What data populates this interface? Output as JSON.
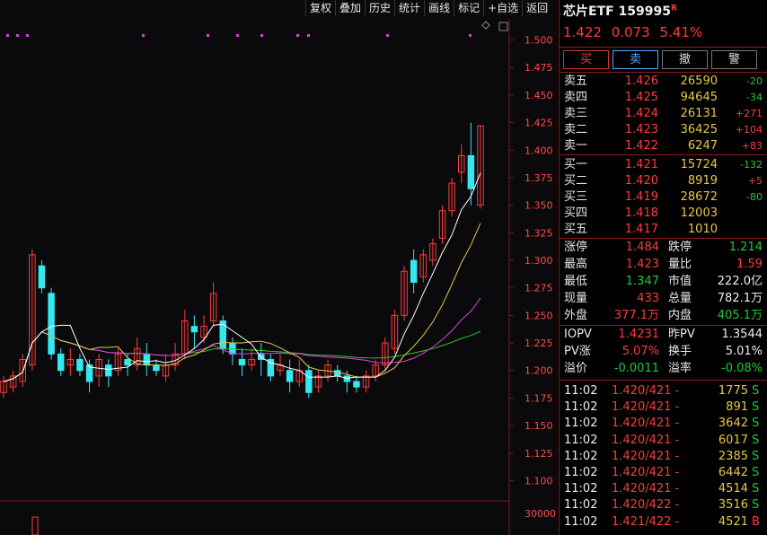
{
  "toolbar": [
    "复权",
    "叠加",
    "历史",
    "统计",
    "画线",
    "标记",
    "+自选",
    "返回"
  ],
  "quote": {
    "name": "芯片ETF 159995",
    "flag": "R",
    "price": "1.422",
    "change": "0.073",
    "pct": "5.41%"
  },
  "actions": [
    "买",
    "卖",
    "撤",
    "警"
  ],
  "asks": [
    {
      "label": "卖五",
      "price": "1.426",
      "vol": "26590",
      "delta": "-20"
    },
    {
      "label": "卖四",
      "price": "1.425",
      "vol": "94645",
      "delta": "-34"
    },
    {
      "label": "卖三",
      "price": "1.424",
      "vol": "26131",
      "delta": "+271"
    },
    {
      "label": "卖二",
      "price": "1.423",
      "vol": "36425",
      "delta": "+104"
    },
    {
      "label": "卖一",
      "price": "1.422",
      "vol": "6247",
      "delta": "+83"
    }
  ],
  "bids": [
    {
      "label": "买一",
      "price": "1.421",
      "vol": "15724",
      "delta": "-132"
    },
    {
      "label": "买二",
      "price": "1.420",
      "vol": "8919",
      "delta": "+5"
    },
    {
      "label": "买三",
      "price": "1.419",
      "vol": "28672",
      "delta": "-80"
    },
    {
      "label": "买四",
      "price": "1.418",
      "vol": "12003",
      "delta": ""
    },
    {
      "label": "买五",
      "price": "1.417",
      "vol": "1010",
      "delta": ""
    }
  ],
  "stats": [
    {
      "k1": "涨停",
      "v1": "1.484",
      "c1": "red",
      "k2": "跌停",
      "v2": "1.214",
      "c2": "grn"
    },
    {
      "k1": "最高",
      "v1": "1.423",
      "c1": "red",
      "k2": "量比",
      "v2": "1.59",
      "c2": "red"
    },
    {
      "k1": "最低",
      "v1": "1.347",
      "c1": "grn",
      "k2": "市值",
      "v2": "222.0亿",
      "c2": "wht"
    },
    {
      "k1": "现量",
      "v1": "433",
      "c1": "red",
      "k2": "总量",
      "v2": "782.1万",
      "c2": "wht"
    },
    {
      "k1": "外盘",
      "v1": "377.1万",
      "c1": "red",
      "k2": "内盘",
      "v2": "405.1万",
      "c2": "grn"
    }
  ],
  "stats2": [
    {
      "k1": "IOPV",
      "v1": "1.4231",
      "c1": "red",
      "k2": "昨PV",
      "v2": "1.3544",
      "c2": "wht"
    },
    {
      "k1": "PV涨",
      "v1": "5.07%",
      "c1": "red",
      "k2": "换手",
      "v2": "5.01%",
      "c2": "wht"
    },
    {
      "k1": "溢价",
      "v1": "-0.0011",
      "c1": "grn",
      "k2": "溢率",
      "v2": "-0.08%",
      "c2": "grn"
    }
  ],
  "ticks": [
    {
      "time": "11:02",
      "price": "1.420/421 -",
      "vol": "1775",
      "side": "S"
    },
    {
      "time": "11:02",
      "price": "1.420/421 -",
      "vol": "891",
      "side": "S"
    },
    {
      "time": "11:02",
      "price": "1.420/421 -",
      "vol": "3642",
      "side": "S"
    },
    {
      "time": "11:02",
      "price": "1.420/421 -",
      "vol": "6017",
      "side": "S"
    },
    {
      "time": "11:02",
      "price": "1.420/421 -",
      "vol": "2385",
      "side": "S"
    },
    {
      "time": "11:02",
      "price": "1.420/421 -",
      "vol": "6442",
      "side": "S"
    },
    {
      "time": "11:02",
      "price": "1.420/421 -",
      "vol": "4514",
      "side": "S"
    },
    {
      "time": "11:02",
      "price": "1.420/422 -",
      "vol": "3516",
      "side": "S"
    },
    {
      "time": "11:02",
      "price": "1.421/422 -",
      "vol": "4521",
      "side": "B"
    }
  ],
  "chart_data": {
    "type": "candlestick",
    "ylim": [
      1.08,
      1.52
    ],
    "yticks": [
      "1.500",
      "1.475",
      "1.450",
      "1.425",
      "1.400",
      "1.375",
      "1.350",
      "1.325",
      "1.300",
      "1.275",
      "1.250",
      "1.225",
      "1.200",
      "1.175",
      "1.150",
      "1.125",
      "1.100"
    ],
    "volume_tick": "30000",
    "grid": false,
    "colors": {
      "up": "#ff3b3b",
      "down": "#34e8f0",
      "ma5": "#ffffff",
      "ma10": "#e6c846",
      "ma20": "#e040e0",
      "ma60": "#2ec82e"
    },
    "candles": [
      [
        1.18,
        1.19,
        1.175,
        1.195
      ],
      [
        1.185,
        1.195,
        1.18,
        1.2
      ],
      [
        1.19,
        1.21,
        1.185,
        1.215
      ],
      [
        1.205,
        1.305,
        1.2,
        1.31
      ],
      [
        1.295,
        1.275,
        1.27,
        1.3
      ],
      [
        1.27,
        1.215,
        1.21,
        1.275
      ],
      [
        1.215,
        1.2,
        1.195,
        1.22
      ],
      [
        1.205,
        1.21,
        1.195,
        1.22
      ],
      [
        1.21,
        1.2,
        1.195,
        1.215
      ],
      [
        1.205,
        1.19,
        1.18,
        1.21
      ],
      [
        1.195,
        1.21,
        1.185,
        1.215
      ],
      [
        1.205,
        1.195,
        1.185,
        1.21
      ],
      [
        1.2,
        1.215,
        1.195,
        1.22
      ],
      [
        1.21,
        1.205,
        1.195,
        1.215
      ],
      [
        1.205,
        1.22,
        1.2,
        1.23
      ],
      [
        1.215,
        1.205,
        1.195,
        1.225
      ],
      [
        1.205,
        1.2,
        1.195,
        1.21
      ],
      [
        1.195,
        1.205,
        1.19,
        1.215
      ],
      [
        1.205,
        1.215,
        1.2,
        1.225
      ],
      [
        1.215,
        1.245,
        1.21,
        1.255
      ],
      [
        1.24,
        1.235,
        1.22,
        1.25
      ],
      [
        1.23,
        1.24,
        1.225,
        1.25
      ],
      [
        1.245,
        1.27,
        1.24,
        1.28
      ],
      [
        1.245,
        1.22,
        1.215,
        1.25
      ],
      [
        1.225,
        1.215,
        1.205,
        1.23
      ],
      [
        1.21,
        1.205,
        1.195,
        1.22
      ],
      [
        1.205,
        1.21,
        1.2,
        1.22
      ],
      [
        1.215,
        1.21,
        1.195,
        1.225
      ],
      [
        1.21,
        1.195,
        1.19,
        1.215
      ],
      [
        1.2,
        1.205,
        1.195,
        1.215
      ],
      [
        1.2,
        1.19,
        1.18,
        1.21
      ],
      [
        1.19,
        1.2,
        1.185,
        1.21
      ],
      [
        1.2,
        1.18,
        1.175,
        1.205
      ],
      [
        1.185,
        1.195,
        1.18,
        1.2
      ],
      [
        1.195,
        1.205,
        1.19,
        1.21
      ],
      [
        1.2,
        1.195,
        1.19,
        1.205
      ],
      [
        1.195,
        1.19,
        1.18,
        1.2
      ],
      [
        1.19,
        1.185,
        1.18,
        1.195
      ],
      [
        1.185,
        1.195,
        1.18,
        1.2
      ],
      [
        1.195,
        1.205,
        1.19,
        1.21
      ],
      [
        1.205,
        1.225,
        1.2,
        1.23
      ],
      [
        1.22,
        1.25,
        1.215,
        1.255
      ],
      [
        1.25,
        1.29,
        1.245,
        1.295
      ],
      [
        1.3,
        1.28,
        1.27,
        1.31
      ],
      [
        1.285,
        1.305,
        1.28,
        1.31
      ],
      [
        1.3,
        1.315,
        1.295,
        1.32
      ],
      [
        1.32,
        1.345,
        1.315,
        1.35
      ],
      [
        1.345,
        1.37,
        1.34,
        1.375
      ],
      [
        1.38,
        1.395,
        1.37,
        1.405
      ],
      [
        1.395,
        1.365,
        1.35,
        1.425
      ],
      [
        1.35,
        1.422,
        1.347,
        1.423
      ]
    ]
  }
}
